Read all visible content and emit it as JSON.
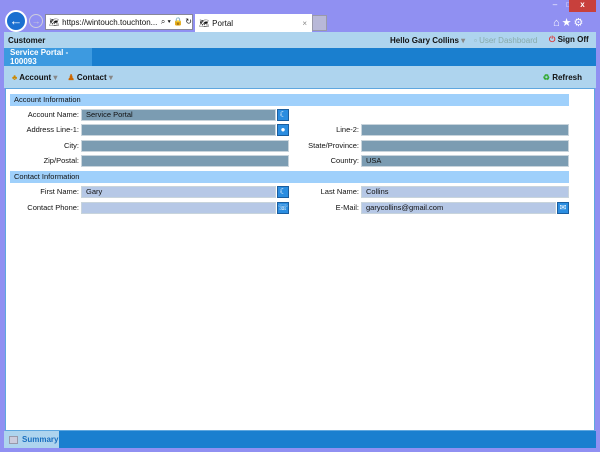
{
  "browser": {
    "url": "https://wintouch.touchton...",
    "tab_title": "Portal"
  },
  "header": {
    "title": "Customer",
    "greeting": "Hello Gary Collins",
    "dashboard": "User Dashboard",
    "sign_off": "Sign Off"
  },
  "portal_tab": "Service Portal - 100093",
  "toolbar": {
    "account": "Account",
    "contact": "Contact",
    "refresh": "Refresh"
  },
  "account_section": {
    "title": "Account Information",
    "account_name": {
      "label": "Account Name:",
      "value": "Service Portal"
    },
    "address1": {
      "label": "Address Line-1:",
      "value": ""
    },
    "line2": {
      "label": "Line-2:",
      "value": ""
    },
    "city": {
      "label": "City:",
      "value": ""
    },
    "state": {
      "label": "State/Province:",
      "value": ""
    },
    "zip": {
      "label": "Zip/Postal:",
      "value": ""
    },
    "country": {
      "label": "Country:",
      "value": "USA"
    }
  },
  "contact_section": {
    "title": "Contact Information",
    "first_name": {
      "label": "First Name:",
      "value": "Gary"
    },
    "last_name": {
      "label": "Last Name:",
      "value": "Collins"
    },
    "phone": {
      "label": "Contact Phone:",
      "value": ""
    },
    "email": {
      "label": "E-Mail:",
      "value": "garycollins@gmail.com"
    }
  },
  "bottom_tab": "Summary"
}
